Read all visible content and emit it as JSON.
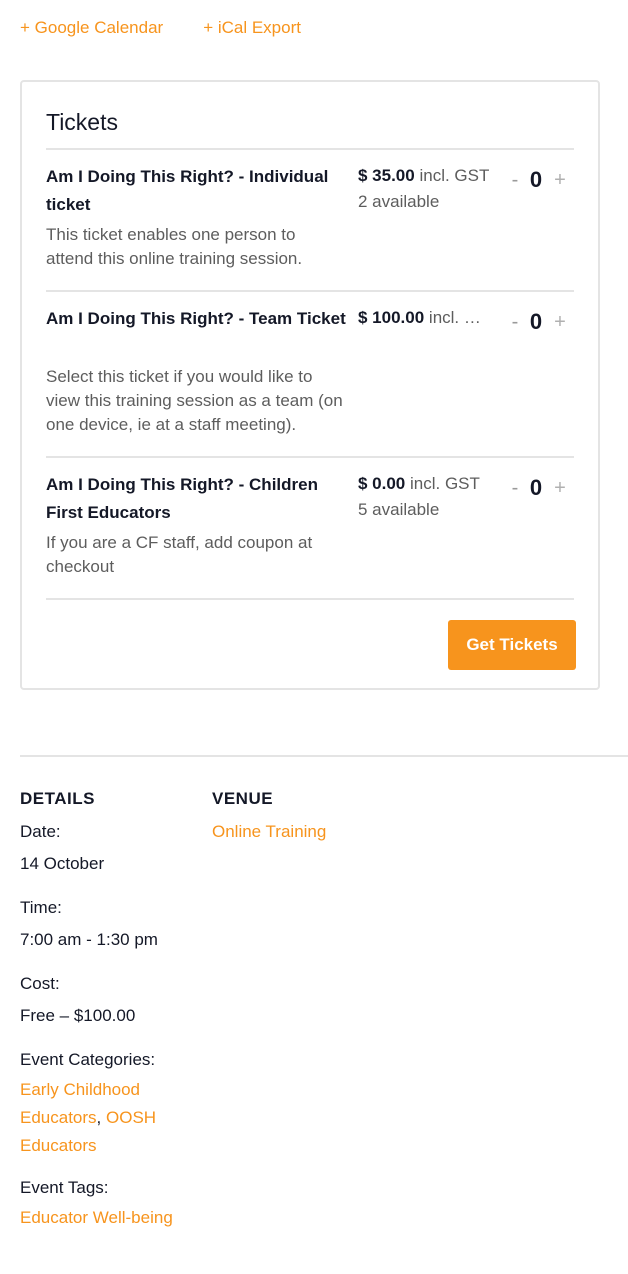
{
  "export_links": {
    "google_calendar": "+ Google Calendar",
    "ical_export": "+ iCal Export"
  },
  "tickets": {
    "title": "Tickets",
    "items": [
      {
        "name": "Am I Doing This Right? - Individual ticket",
        "description": "This ticket enables one person to attend this online training session.",
        "price": "$ 35.00",
        "price_suffix": " incl. GST",
        "availability": "2 available",
        "quantity": "0"
      },
      {
        "name": "Am I Doing This Right? - Team Ticket",
        "description": "Select this ticket if you would like to view this training session as a team (on one device, ie at a staff meeting).",
        "price": "$ 100.00",
        "price_suffix": " incl. …",
        "availability": "",
        "quantity": "0"
      },
      {
        "name": "Am I Doing This Right? - Children First Educators",
        "description": "If you are a CF staff, add coupon at checkout",
        "price": "$ 0.00",
        "price_suffix": " incl. GST",
        "availability": "5 available",
        "quantity": "0"
      }
    ],
    "qty_minus": "-",
    "qty_plus": "+",
    "submit_label": "Get Tickets"
  },
  "details": {
    "heading": "DETAILS",
    "date_label": "Date:",
    "date_value": "14 October",
    "time_label": "Time:",
    "time_value": "7:00 am - 1:30 pm",
    "cost_label": "Cost:",
    "cost_value": "Free – $100.00",
    "categories_label": "Event Categories:",
    "categories": [
      "Early Childhood Educators",
      "OOSH Educators"
    ],
    "categories_separator": ", ",
    "tags_label": "Event Tags:",
    "tags": [
      "Educator Well-being"
    ]
  },
  "venue": {
    "heading": "VENUE",
    "name": "Online Training"
  },
  "colors": {
    "accent": "#f7941d",
    "text": "#141827",
    "muted": "#5d5d5d",
    "border": "#e4e4e4"
  }
}
